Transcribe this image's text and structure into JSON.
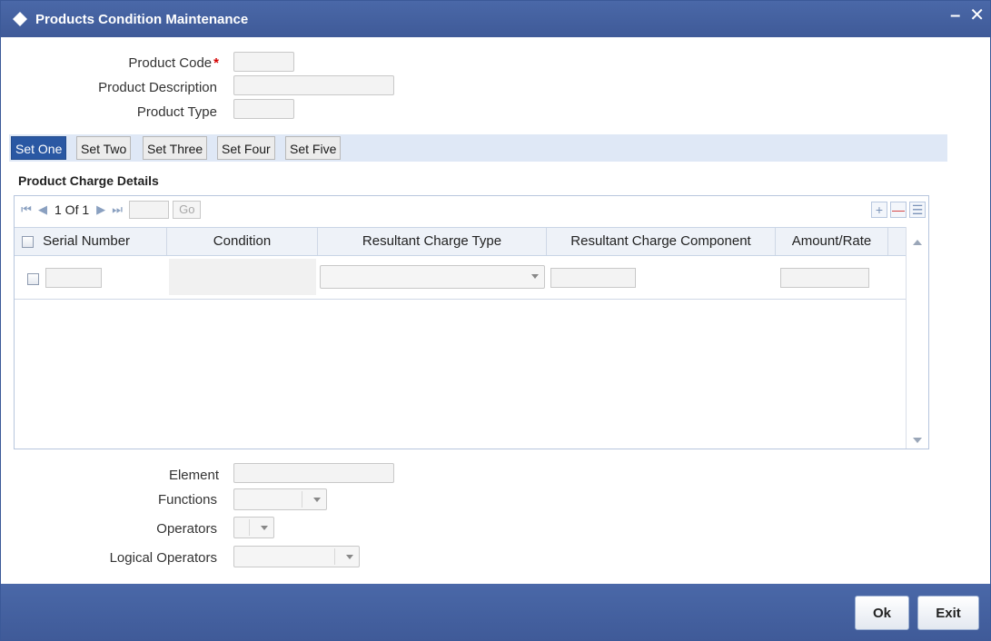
{
  "window": {
    "title": "Products Condition Maintenance",
    "minimize_label": "–",
    "close_label": "✕"
  },
  "header_fields": {
    "product_code_label": "Product Code",
    "required_marker": "*",
    "product_description_label": "Product Description",
    "product_type_label": "Product Type",
    "product_code_value": "",
    "product_description_value": "",
    "product_type_value": ""
  },
  "tabs": [
    {
      "label": "Set One",
      "active": true
    },
    {
      "label": "Set Two",
      "active": false
    },
    {
      "label": "Set Three",
      "active": false
    },
    {
      "label": "Set Four",
      "active": false
    },
    {
      "label": "Set Five",
      "active": false
    }
  ],
  "details": {
    "section_title": "Product Charge Details",
    "pager_text": "1 Of 1",
    "go_label": "Go",
    "columns": [
      "Serial Number",
      "Condition",
      "Resultant Charge Type",
      "Resultant Charge Component",
      "Amount/Rate"
    ],
    "rows": [
      {
        "serial_number": "",
        "condition": "",
        "resultant_charge_type": "",
        "resultant_charge_component": "",
        "amount_rate": ""
      }
    ]
  },
  "condition_builder": {
    "element_label": "Element",
    "functions_label": "Functions",
    "operators_label": "Operators",
    "logical_operators_label": "Logical Operators",
    "element_value": "",
    "functions_value": "",
    "operators_value": "",
    "logical_operators_value": ""
  },
  "footer": {
    "ok_label": "Ok",
    "exit_label": "Exit"
  },
  "colors": {
    "header_blue": "#3f5a98",
    "tab_active": "#2a58a3",
    "tabbar_bg": "#dfe8f6",
    "required_red": "#d40000"
  }
}
